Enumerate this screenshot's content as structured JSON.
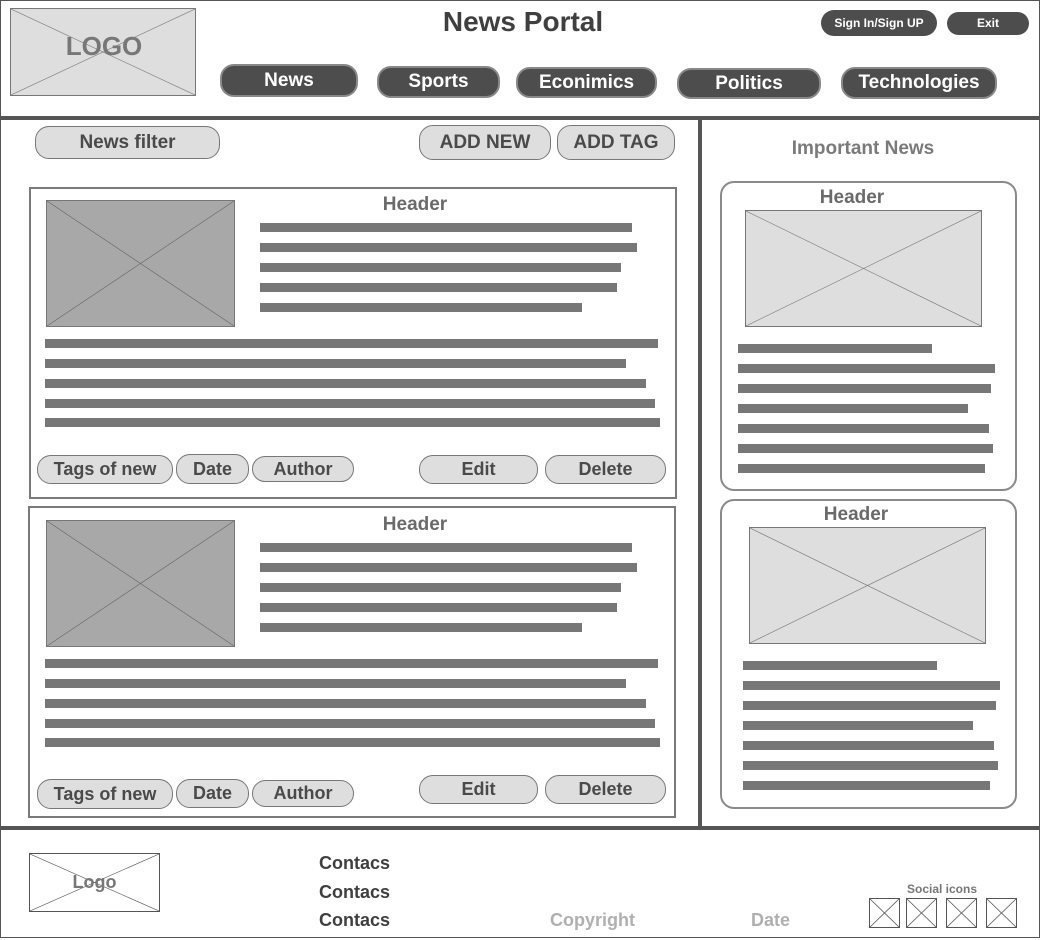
{
  "header": {
    "logo_text": "LOGO",
    "title": "News Portal",
    "sign_in_label": "Sign In/Sign UP",
    "exit_label": "Exit"
  },
  "nav": {
    "items": [
      {
        "label": "News"
      },
      {
        "label": "Sports"
      },
      {
        "label": "Econimics"
      },
      {
        "label": "Politics"
      },
      {
        "label": "Technologies"
      }
    ]
  },
  "toolbar": {
    "filter_label": "News filter",
    "add_new_label": "ADD NEW",
    "add_tag_label": "ADD TAG"
  },
  "news": [
    {
      "header": "Header",
      "tags_label": "Tags of new",
      "date_label": "Date",
      "author_label": "Author",
      "edit_label": "Edit",
      "delete_label": "Delete"
    },
    {
      "header": "Header",
      "tags_label": "Tags of new",
      "date_label": "Date",
      "author_label": "Author",
      "edit_label": "Edit",
      "delete_label": "Delete"
    }
  ],
  "sidebar": {
    "title": "Important News",
    "items": [
      {
        "header": "Header"
      },
      {
        "header": "Header"
      }
    ]
  },
  "footer": {
    "logo_text": "Logo",
    "contacts": [
      "Contacs",
      "Contacs",
      "Contacs"
    ],
    "copyright": "Copyright",
    "date": "Date",
    "social_label": "Social icons"
  },
  "colors": {
    "dark_button": "#4d4d4d",
    "light_button": "#dedede",
    "placeholder_dark": "#a8a8a8",
    "placeholder_light": "#dedede",
    "text_bar": "#777777"
  }
}
